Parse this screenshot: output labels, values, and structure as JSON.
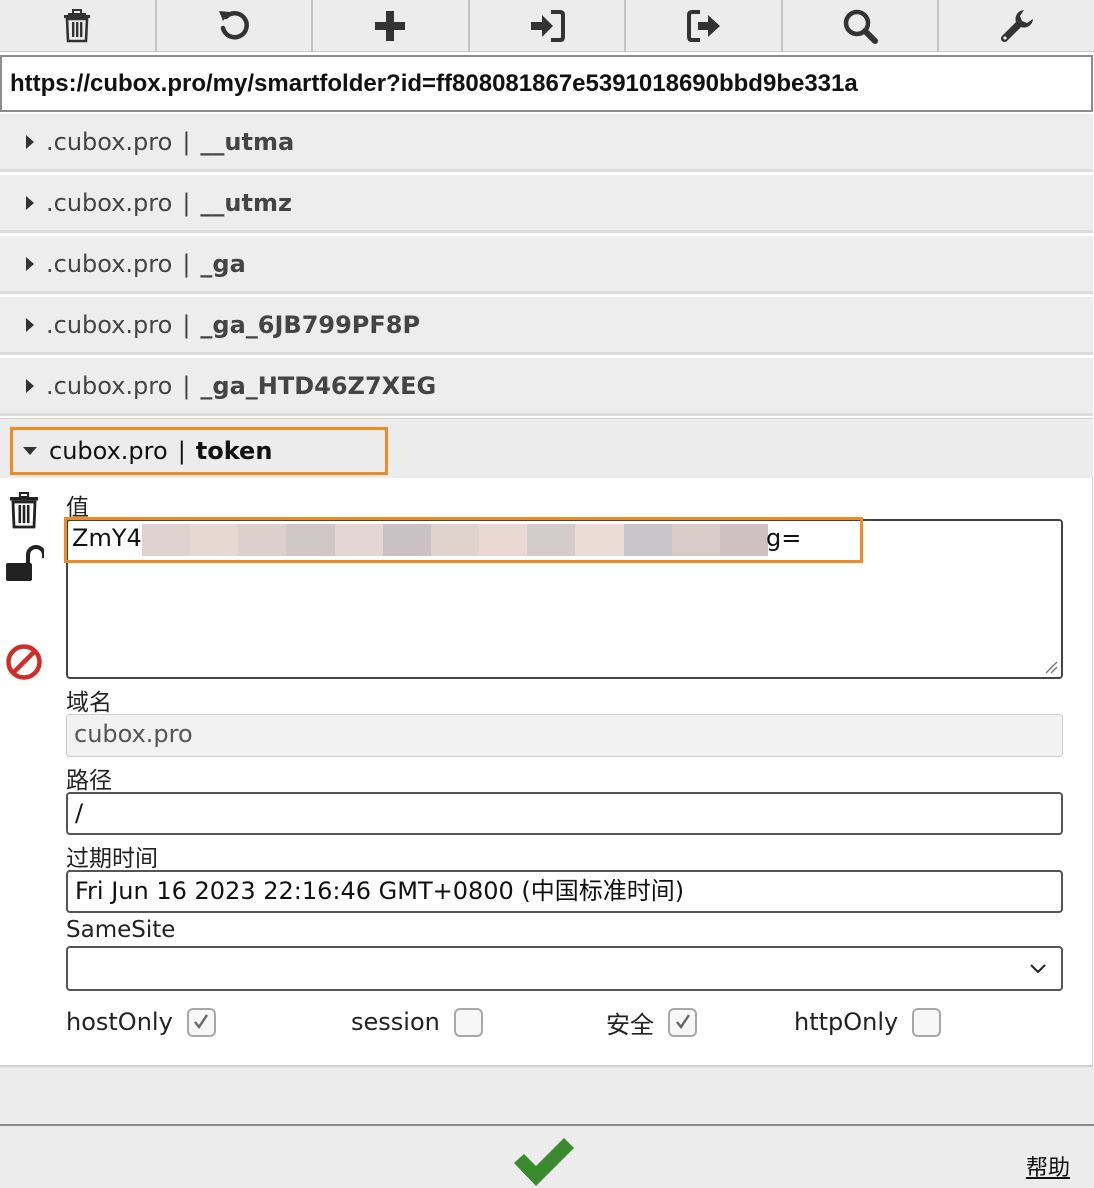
{
  "toolbar": {
    "buttons": [
      {
        "icon": "trash-icon"
      },
      {
        "icon": "refresh-icon"
      },
      {
        "icon": "plus-icon"
      },
      {
        "icon": "import-icon"
      },
      {
        "icon": "export-icon"
      },
      {
        "icon": "search-icon"
      },
      {
        "icon": "wrench-icon"
      }
    ]
  },
  "url": "https://cubox.pro/my/smartfolder?id=ff808081867e5391018690bbd9be331a",
  "separator": "|",
  "cookies": [
    {
      "domain": ".cubox.pro",
      "name": "__utma"
    },
    {
      "domain": ".cubox.pro",
      "name": "__utmz"
    },
    {
      "domain": ".cubox.pro",
      "name": "_ga"
    },
    {
      "domain": ".cubox.pro",
      "name": "_ga_6JB799PF8P"
    },
    {
      "domain": ".cubox.pro",
      "name": "_ga_HTD46Z7XEG"
    }
  ],
  "selected_cookie": {
    "domain": "cubox.pro",
    "name": "token",
    "labels": {
      "value": "值",
      "domain": "域名",
      "path": "路径",
      "expiration": "过期时间",
      "samesite": "SameSite"
    },
    "value_prefix": "ZmY4",
    "value_suffix": "g=",
    "domain_value": "cubox.pro",
    "path_value": "/",
    "expiration_value": "Fri Jun 16 2023 22:16:46 GMT+0800 (中国标准时间)",
    "samesite_value": "",
    "flags": [
      {
        "label": "hostOnly",
        "checked": true
      },
      {
        "label": "session",
        "checked": false
      },
      {
        "label": "安全",
        "checked": true
      },
      {
        "label": "httpOnly",
        "checked": false
      }
    ]
  },
  "footer": {
    "help_label": "帮助"
  },
  "colors": {
    "highlight": "#f08a24",
    "save_green": "#3a8a2e",
    "block_red": "#d42a2a"
  }
}
